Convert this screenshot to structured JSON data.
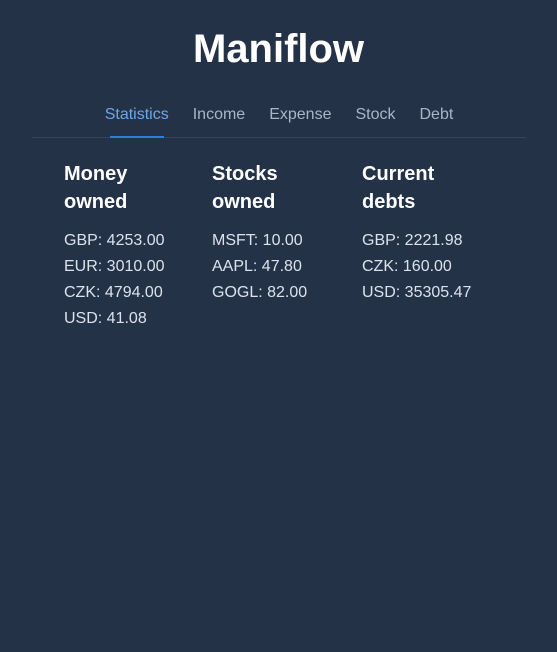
{
  "app": {
    "title": "Maniflow"
  },
  "tabs": [
    {
      "label": "Statistics",
      "active": true
    },
    {
      "label": "Income",
      "active": false
    },
    {
      "label": "Expense",
      "active": false
    },
    {
      "label": "Stock",
      "active": false
    },
    {
      "label": "Debt",
      "active": false
    }
  ],
  "stats": {
    "money": {
      "heading": "Money owned",
      "items": [
        "GBP: 4253.00",
        "EUR: 3010.00",
        "CZK: 4794.00",
        "USD: 41.08"
      ]
    },
    "stocks": {
      "heading": "Stocks owned",
      "items": [
        "MSFT: 10.00",
        "AAPL: 47.80",
        "GOGL: 82.00"
      ]
    },
    "debts": {
      "heading": "Current debts",
      "items": [
        "GBP: 2221.98",
        "CZK: 160.00",
        "USD: 35305.47"
      ]
    }
  },
  "colors": {
    "background": "#243247",
    "accent": "#2b7de0",
    "active_tab": "#6ea6e6"
  }
}
